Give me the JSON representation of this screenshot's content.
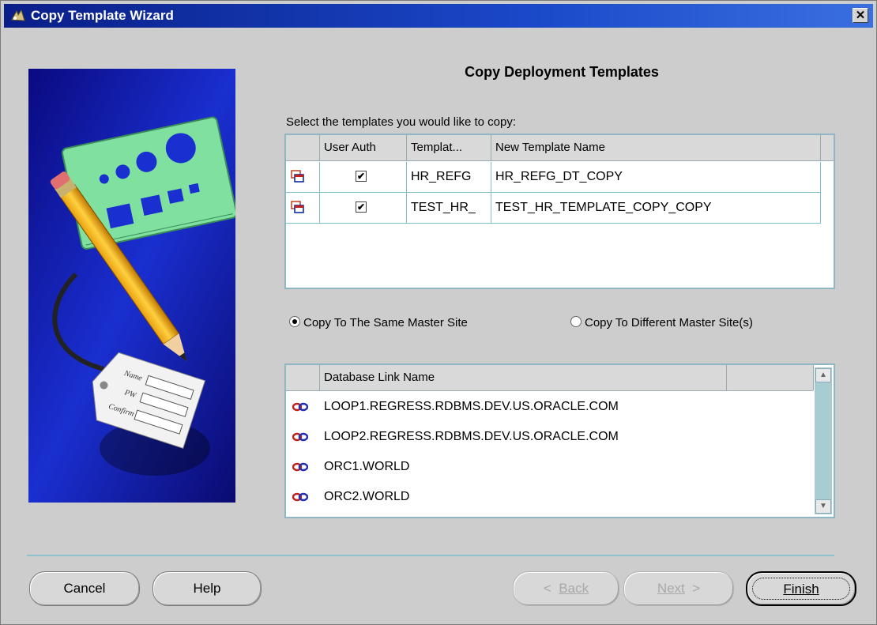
{
  "window": {
    "title": "Copy Template Wizard",
    "close_glyph": "✕"
  },
  "page": {
    "heading": "Copy Deployment Templates",
    "prompt": "Select the templates you would like to copy:"
  },
  "templates_table": {
    "columns": [
      "User Auth",
      "Templat...",
      "New Template Name"
    ],
    "rows": [
      {
        "icon": "template-icon",
        "user_auth": true,
        "template": "HR_REFG",
        "new_name": "HR_REFG_DT_COPY"
      },
      {
        "icon": "template-icon",
        "user_auth": true,
        "template": "TEST_HR_",
        "new_name": "TEST_HR_TEMPLATE_COPY_COPY"
      }
    ],
    "check_glyph": "✔"
  },
  "copy_options": {
    "same": "Copy To The Same Master Site",
    "different": "Copy To Different Master Site(s)",
    "selected": "same"
  },
  "links_table": {
    "column": "Database Link Name",
    "rows": [
      "LOOP1.REGRESS.RDBMS.DEV.US.ORACLE.COM",
      "LOOP2.REGRESS.RDBMS.DEV.US.ORACLE.COM",
      "ORC1.WORLD",
      "ORC2.WORLD"
    ]
  },
  "buttons": {
    "cancel": "Cancel",
    "help": "Help",
    "back_arrow": "<",
    "back": "Back",
    "next": "Next",
    "next_arrow": ">",
    "finish": "Finish"
  },
  "colors": {
    "title_bar": "#0a1e88",
    "accent_border": "#7fbfc9",
    "art_background": "#1a2fd0"
  }
}
